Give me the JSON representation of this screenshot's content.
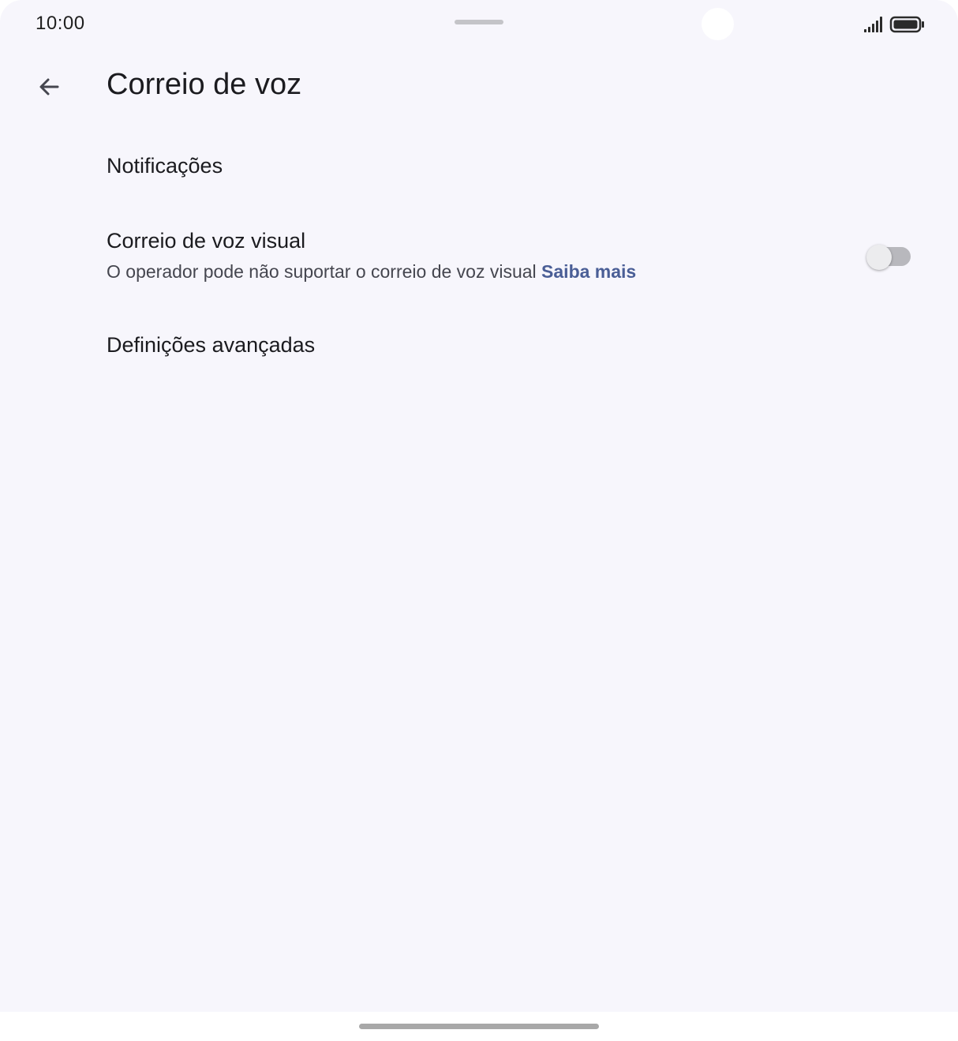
{
  "status_bar": {
    "time": "10:00"
  },
  "app_bar": {
    "title": "Correio de voz",
    "back_icon": "arrow-back-icon"
  },
  "preferences": {
    "notifications": {
      "title": "Notificações"
    },
    "visual_voicemail": {
      "title": "Correio de voz visual",
      "summary": "O operador pode não suportar o correio de voz visual",
      "link": "Saiba mais",
      "enabled": false
    },
    "advanced": {
      "title": "Definições avançadas"
    }
  },
  "colors": {
    "background": "#f7f6fc",
    "link": "#4a5e96",
    "switch_track_off": "#b8b8bd"
  }
}
